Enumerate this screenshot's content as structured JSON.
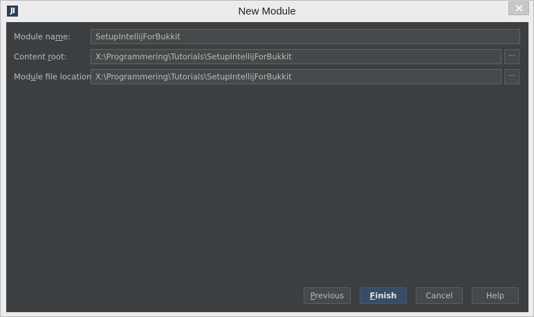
{
  "window": {
    "title": "New Module",
    "app_icon_glyph": "JI"
  },
  "form": {
    "module_name": {
      "label_pre": "Module na",
      "label_mnemonic": "m",
      "label_post": "e:",
      "value": "SetupIntellijForBukkit"
    },
    "content_root": {
      "label_pre": "Content ",
      "label_mnemonic": "r",
      "label_post": "oot:",
      "value": "X:\\Programmering\\Tutorials\\SetupIntellijForBukkit",
      "browse_label": "..."
    },
    "module_file_location": {
      "label_pre": "Mod",
      "label_mnemonic": "u",
      "label_post": "le file location:",
      "value": "X:\\Programmering\\Tutorials\\SetupIntellijForBukkit",
      "browse_label": "..."
    }
  },
  "buttons": {
    "previous": {
      "mnemonic": "P",
      "rest": "revious"
    },
    "finish": {
      "mnemonic": "F",
      "rest": "inish"
    },
    "cancel": {
      "label": "Cancel"
    },
    "help": {
      "label": "Help"
    }
  },
  "colors": {
    "panel_bg": "#3c3f41",
    "field_bg": "#45494a",
    "default_button_bg": "#384c66",
    "text": "#bbbbbb"
  },
  "icons": {
    "app": "intellij-idea-icon",
    "close": "close-icon"
  }
}
